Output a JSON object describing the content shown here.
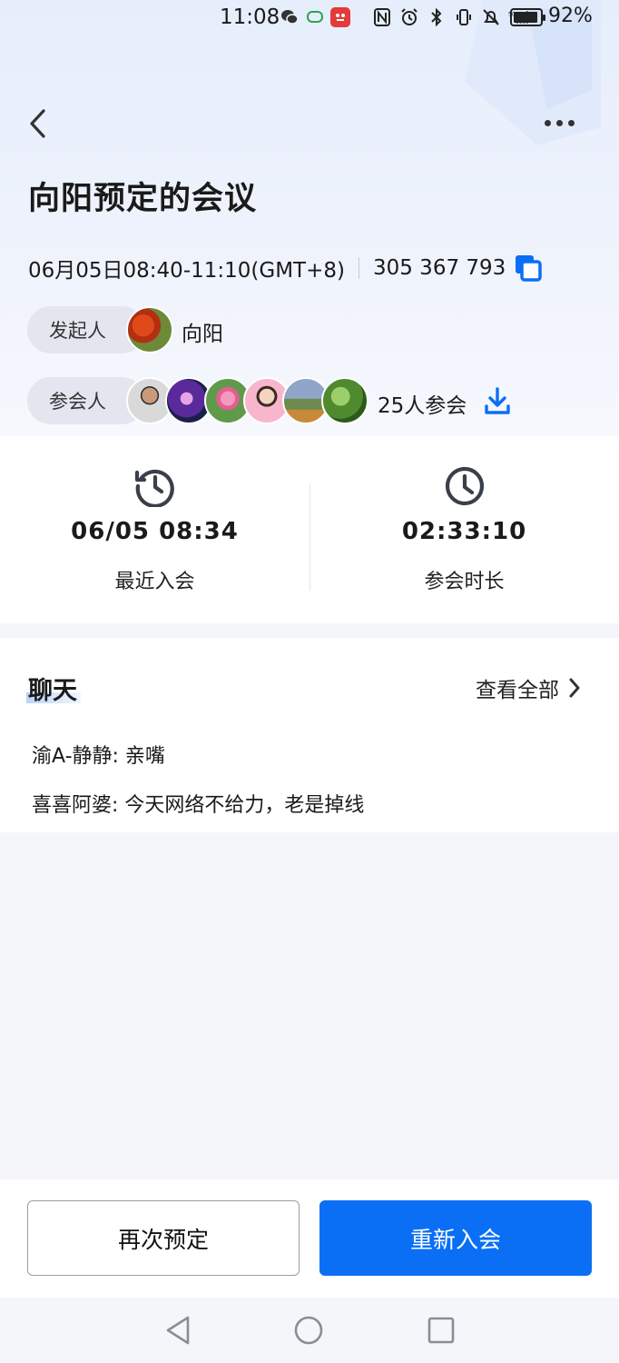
{
  "status_bar": {
    "time": "11:08",
    "battery_percent": "92%",
    "battery_level": 0.92
  },
  "header": {
    "title": "向阳预定的会议"
  },
  "meeting": {
    "datetime": "06月05日08:40-11:10(GMT+8)",
    "meeting_id": "305 367 793"
  },
  "host": {
    "label": "发起人",
    "name": "向阳"
  },
  "attendees": {
    "label": "参会人",
    "count_text": "25人参会"
  },
  "stats": {
    "recent_join_value": "06/05 08:34",
    "recent_join_label": "最近入会",
    "duration_value": "02:33:10",
    "duration_label": "参会时长"
  },
  "chat": {
    "title": "聊天",
    "view_all": "查看全部",
    "messages": [
      {
        "text": "渝A-静静: 亲嘴"
      },
      {
        "text": "喜喜阿婆: 今天网络不给力，老是掉线"
      }
    ]
  },
  "actions": {
    "rebook": "再次预定",
    "rejoin": "重新入会"
  },
  "colors": {
    "accent": "#0a6ff5",
    "pill_bg": "#e3e6ee"
  }
}
